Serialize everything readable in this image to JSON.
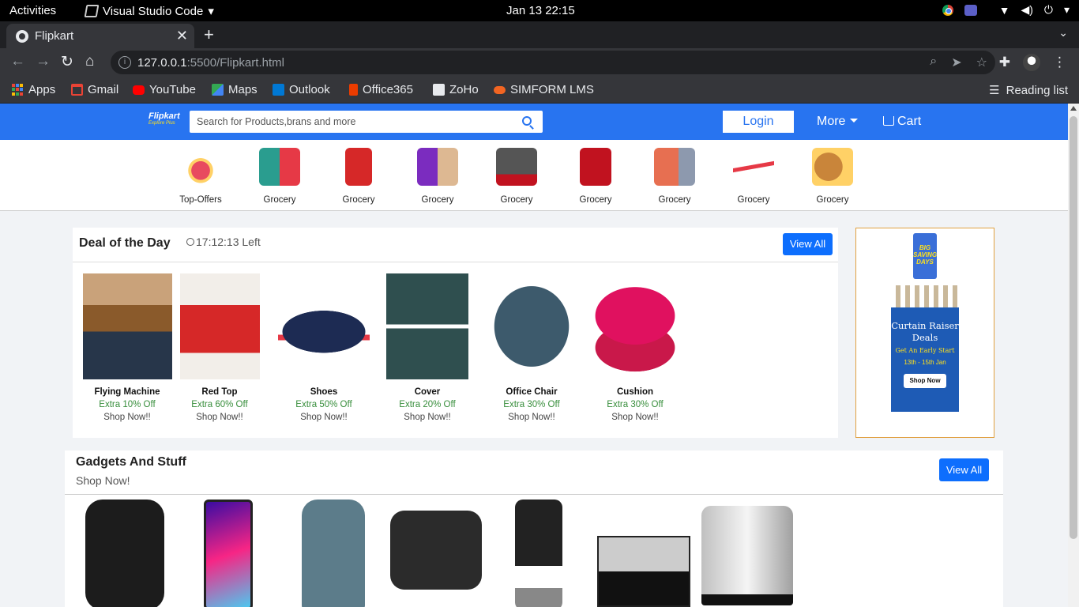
{
  "os_bar": {
    "activities": "Activities",
    "app_name": "Visual Studio Code",
    "clock": "Jan 13  22:15"
  },
  "browser": {
    "tab_title": "Flipkart",
    "url_host": "127.0.0.1",
    "url_path": ":5500/Flipkart.html",
    "bookmarks": [
      {
        "label": "Apps",
        "icon": "apps-grid-icon"
      },
      {
        "label": "Gmail",
        "icon": "gmail-icon",
        "color": "#ea4335"
      },
      {
        "label": "YouTube",
        "icon": "youtube-icon",
        "color": "#ff0000"
      },
      {
        "label": "Maps",
        "icon": "maps-icon",
        "color": "#34a853"
      },
      {
        "label": "Outlook",
        "icon": "outlook-icon",
        "color": "#0078d4"
      },
      {
        "label": "Office365",
        "icon": "office365-icon",
        "color": "#eb3c00"
      },
      {
        "label": "ZoHo",
        "icon": "zoho-icon",
        "color": "#e8eaed"
      },
      {
        "label": "SIMFORM LMS",
        "icon": "simform-icon",
        "color": "#f26522"
      }
    ],
    "reading_list": "Reading list"
  },
  "header": {
    "logo_text": "Flipkart",
    "logo_sub": "Explore Plus",
    "search_placeholder": "Search for Products,brans and more",
    "login_label": "Login",
    "more_label": "More",
    "cart_label": "Cart",
    "brand_color": "#2874f0"
  },
  "categories": [
    {
      "label": "Top-Offers",
      "color": "#e84a5f"
    },
    {
      "label": "Grocery",
      "color": "#2a9d8f"
    },
    {
      "label": "Grocery",
      "color": "#d62828"
    },
    {
      "label": "Grocery",
      "color": "#7b2cbf"
    },
    {
      "label": "Grocery",
      "color": "#555555"
    },
    {
      "label": "Grocery",
      "color": "#c1121f"
    },
    {
      "label": "Grocery",
      "color": "#8d99ae"
    },
    {
      "label": "Grocery",
      "color": "#e63946"
    },
    {
      "label": "Grocery",
      "color": "#e0a040"
    }
  ],
  "deal": {
    "title": "Deal of the Day",
    "timer": "17:12:13 Left",
    "view_all": "View All",
    "items": [
      {
        "name": "Flying Machine",
        "offer": "Extra 10% Off",
        "shop": "Shop Now!!"
      },
      {
        "name": "Red Top",
        "offer": "Extra 60% Off",
        "shop": "Shop Now!!"
      },
      {
        "name": "Shoes",
        "offer": "Extra 50% Off",
        "shop": "Shop Now!!"
      },
      {
        "name": "Cover",
        "offer": "Extra 20% Off",
        "shop": "Shop Now!!"
      },
      {
        "name": "Office Chair",
        "offer": "Extra 30% Off",
        "shop": "Shop Now!!"
      },
      {
        "name": "Cushion",
        "offer": "Extra 30% Off",
        "shop": "Shop Now!!"
      }
    ]
  },
  "ad": {
    "bag_line1": "BIG",
    "bag_line2": "SAVING",
    "bag_line3": "DAYS",
    "line1": "Curtain Raiser",
    "line2": "Deals",
    "line3": "Get An Early Start",
    "dates": "13th - 15th Jan",
    "cta": "Shop Now"
  },
  "gadgets": {
    "title": "Gadgets And Stuff",
    "subtitle": "Shop Now!",
    "view_all": "View All",
    "items": [
      {
        "icon": "speaker-icon"
      },
      {
        "icon": "smartphone-icon"
      },
      {
        "icon": "backpack-icon"
      },
      {
        "icon": "sofa-icon"
      },
      {
        "icon": "office-chair-icon"
      },
      {
        "icon": "aquarium-icon"
      },
      {
        "icon": "kettle-icon"
      }
    ]
  }
}
